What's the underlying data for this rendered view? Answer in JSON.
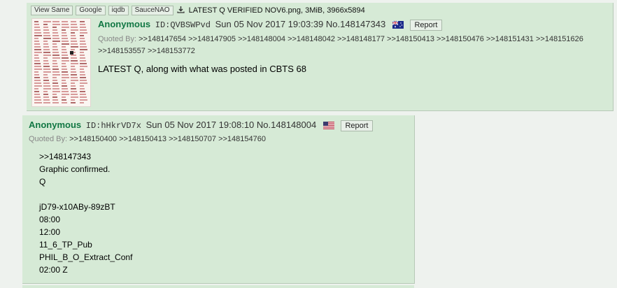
{
  "post1": {
    "file_buttons": [
      "View Same",
      "Google",
      "iqdb",
      "SauceNAO"
    ],
    "filename": "LATEST Q VERIFIED NOV6.png",
    "file_meta": ", 3MiB, 3966x5894",
    "name": "Anonymous",
    "poster_id": "ID:QVBSWPvd",
    "datetime": "Sun 05 Nov 2017 19:03:39",
    "post_no": "No.148147343",
    "flag": "australia-flag",
    "report_label": "Report",
    "quoted_by_label": "Quoted By:",
    "quoted_by": [
      ">>148147654",
      ">>148147905",
      ">>148148004",
      ">>148148042",
      ">>148148177",
      ">>148150413",
      ">>148150476",
      ">>148151431",
      ">>148151626",
      ">>148153557",
      ">>148153772"
    ],
    "message": "LATEST Q, along with what was posted in CBTS 68"
  },
  "post2": {
    "name": "Anonymous",
    "poster_id": "ID:hHkrVD7x",
    "datetime": "Sun 05 Nov 2017 19:08:10",
    "post_no": "No.148148004",
    "flag": "usa-flag",
    "report_label": "Report",
    "quoted_by_label": "Quoted By:",
    "quoted_by": [
      ">>148150400",
      ">>148150413",
      ">>148150707",
      ">>148154760"
    ],
    "message_lines": [
      ">>148147343",
      "Graphic confirmed.",
      "Q",
      "",
      "jD79-x10ABy-89zBT",
      "08:00",
      "12:00",
      "11_6_TP_Pub",
      "PHIL_B_O_Extract_Conf",
      "02:00 Z"
    ]
  },
  "colors": {
    "post_bg": "#d6ead6",
    "page_bg": "#eef2ee",
    "name_color": "#117743"
  }
}
